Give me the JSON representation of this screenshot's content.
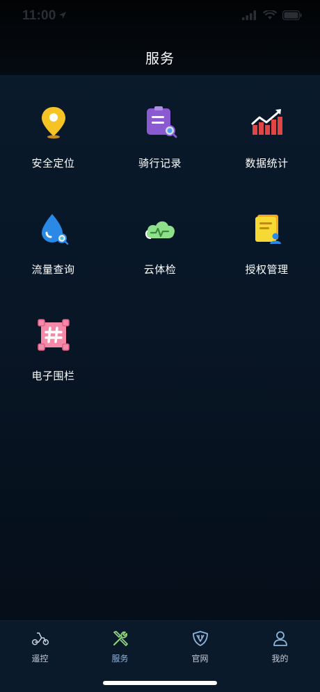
{
  "status_bar": {
    "time": "11:00"
  },
  "header": {
    "title": "服务"
  },
  "services": [
    {
      "label": "安全定位",
      "icon": "location-pin-icon"
    },
    {
      "label": "骑行记录",
      "icon": "ride-record-icon"
    },
    {
      "label": "数据统计",
      "icon": "data-stats-icon"
    },
    {
      "label": "流量查询",
      "icon": "data-usage-icon"
    },
    {
      "label": "云体检",
      "icon": "cloud-check-icon"
    },
    {
      "label": "授权管理",
      "icon": "authorization-icon"
    },
    {
      "label": "电子围栏",
      "icon": "geofence-icon"
    }
  ],
  "tabbar": {
    "items": [
      {
        "label": "遥控",
        "icon": "scooter-icon",
        "active": false
      },
      {
        "label": "服务",
        "icon": "tools-icon",
        "active": true
      },
      {
        "label": "官网",
        "icon": "shield-icon",
        "active": false
      },
      {
        "label": "我的",
        "icon": "person-icon",
        "active": false
      }
    ]
  },
  "colors": {
    "background": "#07111d",
    "tabbar_bg": "#0b1a2a",
    "active_tab": "#8fb6dc",
    "inactive_tab": "#c6ced8"
  }
}
